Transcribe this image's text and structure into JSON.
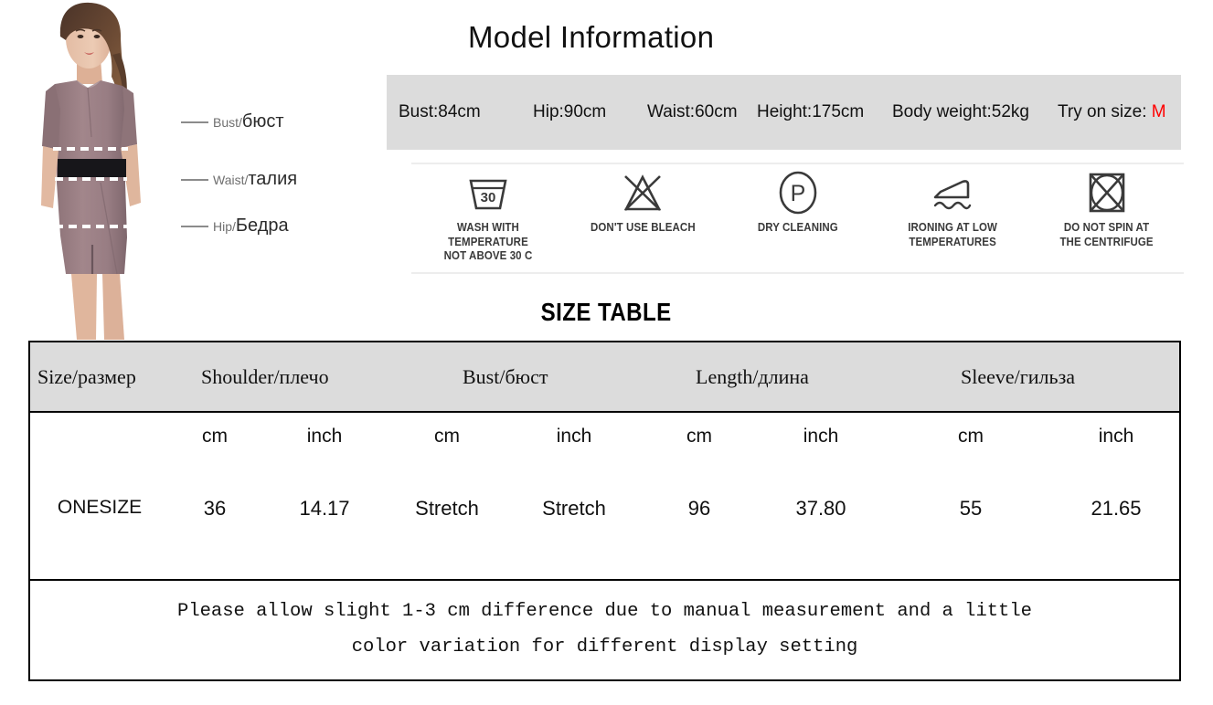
{
  "model_photo": {
    "annotations": [
      {
        "en": "Bust/",
        "ru": "бюст"
      },
      {
        "en": "Waist/",
        "ru": "талия"
      },
      {
        "en": "Hip/",
        "ru": "Бедра"
      }
    ]
  },
  "model_information": {
    "title": "Model Information",
    "bust": "Bust:84cm",
    "hip": "Hip:90cm",
    "waist": "Waist:60cm",
    "height": "Height:175cm",
    "body_weight": "Body weight:52kg",
    "try_on_label": "Try on size:",
    "try_on_size": "M",
    "try_on_color": "#ff0000",
    "band_color": "#dcdcdc"
  },
  "care_instructions": [
    {
      "icon": "wash-tub-30-icon",
      "label": "WASH WITH TEMPERATURE\nNOT ABOVE 30 C"
    },
    {
      "icon": "no-bleach-triangle-icon",
      "label": "DON'T USE BLEACH"
    },
    {
      "icon": "dry-cleaning-p-circle-icon",
      "label": "DRY CLEANING"
    },
    {
      "icon": "iron-low-temperature-icon",
      "label": "IRONING AT LOW\nTEMPERATURES"
    },
    {
      "icon": "no-tumble-spin-icon",
      "label": "DO NOT SPIN AT\nTHE CENTRIFUGE"
    }
  ],
  "size_table": {
    "title": "SIZE TABLE",
    "headers": [
      "Size/размер",
      "Shoulder/плечо",
      "Bust/бюст",
      "Length/длина",
      "Sleeve/гильза"
    ],
    "units": [
      "cm",
      "inch",
      "cm",
      "inch",
      "cm",
      "inch",
      "cm",
      "inch"
    ],
    "rows": [
      {
        "size": "ONESIZE",
        "values": [
          "36",
          "14.17",
          "Stretch",
          "Stretch",
          "96",
          "37.80",
          "55",
          "21.65"
        ]
      }
    ],
    "note_line1": "Please allow slight 1-3 cm difference due to manual measurement and a little",
    "note_line2": "color variation for different display setting"
  }
}
